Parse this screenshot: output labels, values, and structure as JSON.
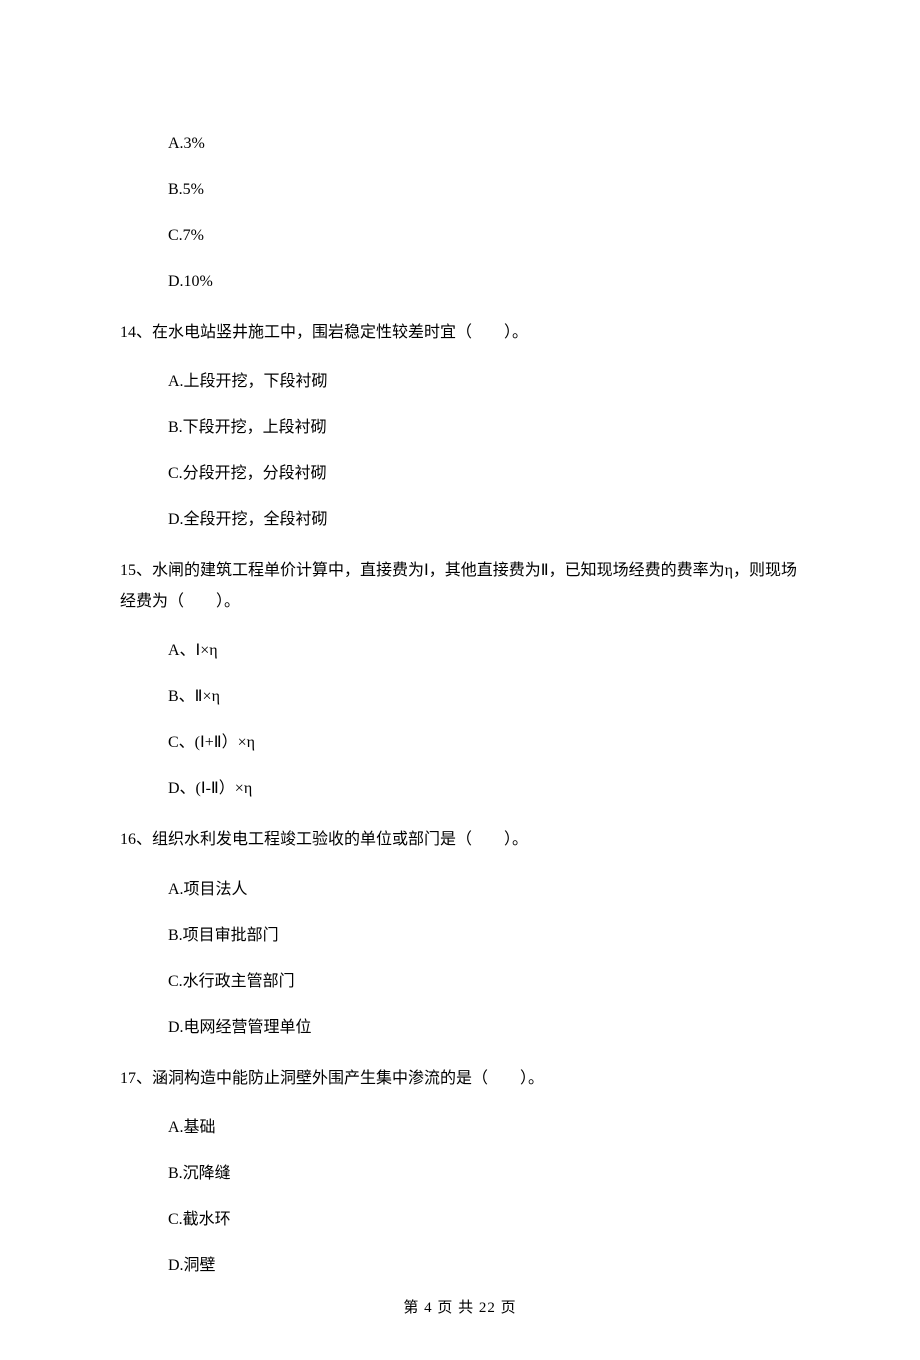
{
  "q13_options": {
    "A": "A.3%",
    "B": "B.5%",
    "C": "C.7%",
    "D": "D.10%"
  },
  "q14": {
    "stem": "14、在水电站竖井施工中，围岩稳定性较差时宜（　　）。",
    "A": "A.上段开挖，下段衬砌",
    "B": "B.下段开挖，上段衬砌",
    "C": "C.分段开挖，分段衬砌",
    "D": "D.全段开挖，全段衬砌"
  },
  "q15": {
    "stem": "15、水闸的建筑工程单价计算中，直接费为Ⅰ，其他直接费为Ⅱ，已知现场经费的费率为η，则现场经费为（　　）。",
    "A": "A、Ⅰ×η",
    "B": "B、Ⅱ×η",
    "C": "C、(Ⅰ+Ⅱ）×η",
    "D": "D、(Ⅰ-Ⅱ）×η"
  },
  "q16": {
    "stem": "16、组织水利发电工程竣工验收的单位或部门是（　　）。",
    "A": "A.项目法人",
    "B": "B.项目审批部门",
    "C": "C.水行政主管部门",
    "D": "D.电网经营管理单位"
  },
  "q17": {
    "stem": "17、涵洞构造中能防止洞壁外围产生集中渗流的是（　　）。",
    "A": "A.基础",
    "B": "B.沉降缝",
    "C": "C.截水环",
    "D": "D.洞壁"
  },
  "footer": "第 4 页 共 22 页"
}
